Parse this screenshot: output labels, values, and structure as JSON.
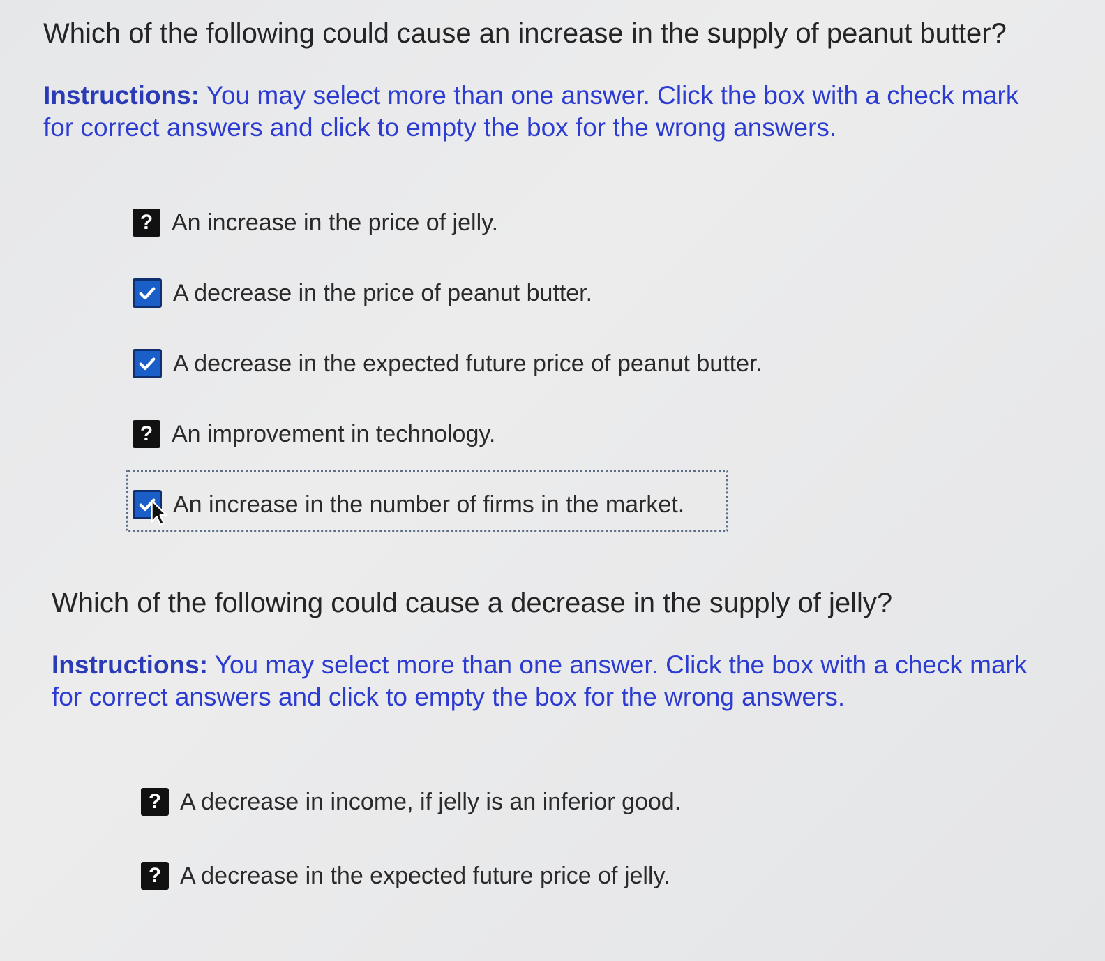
{
  "questions": [
    {
      "prompt": "Which of the following could cause an increase in the supply of peanut butter?",
      "instructions_lead": "Instructions:",
      "instructions_text": " You may select more than one answer. Click the box with a check mark for correct answers and click to empty the box for the wrong answers.",
      "options": [
        {
          "label": "An increase in the price of jelly.",
          "state": "unknown",
          "glyph": "?"
        },
        {
          "label": "A decrease in the price of peanut butter.",
          "state": "checked",
          "glyph": ""
        },
        {
          "label": "A decrease in the expected future price of peanut butter.",
          "state": "checked",
          "glyph": ""
        },
        {
          "label": "An improvement in technology.",
          "state": "unknown",
          "glyph": "?"
        },
        {
          "label": "An increase in the number of firms in the market.",
          "state": "checked",
          "glyph": ""
        }
      ]
    },
    {
      "prompt": "Which of the following could cause a decrease in the supply of jelly?",
      "instructions_lead": "Instructions:",
      "instructions_text": " You may select more than one answer. Click the box with a check mark for correct answers and click to empty the box for the wrong answers.",
      "options": [
        {
          "label": "A decrease in income, if jelly is an inferior good.",
          "state": "unknown",
          "glyph": "?"
        },
        {
          "label": "A decrease in the expected future price of jelly.",
          "state": "unknown",
          "glyph": "?"
        }
      ]
    }
  ],
  "colors": {
    "instructions": "#2c3bd0",
    "checkbox_fill": "#1a5fc7",
    "unknown_fill": "#111111",
    "focus_border": "#5d6e86"
  }
}
